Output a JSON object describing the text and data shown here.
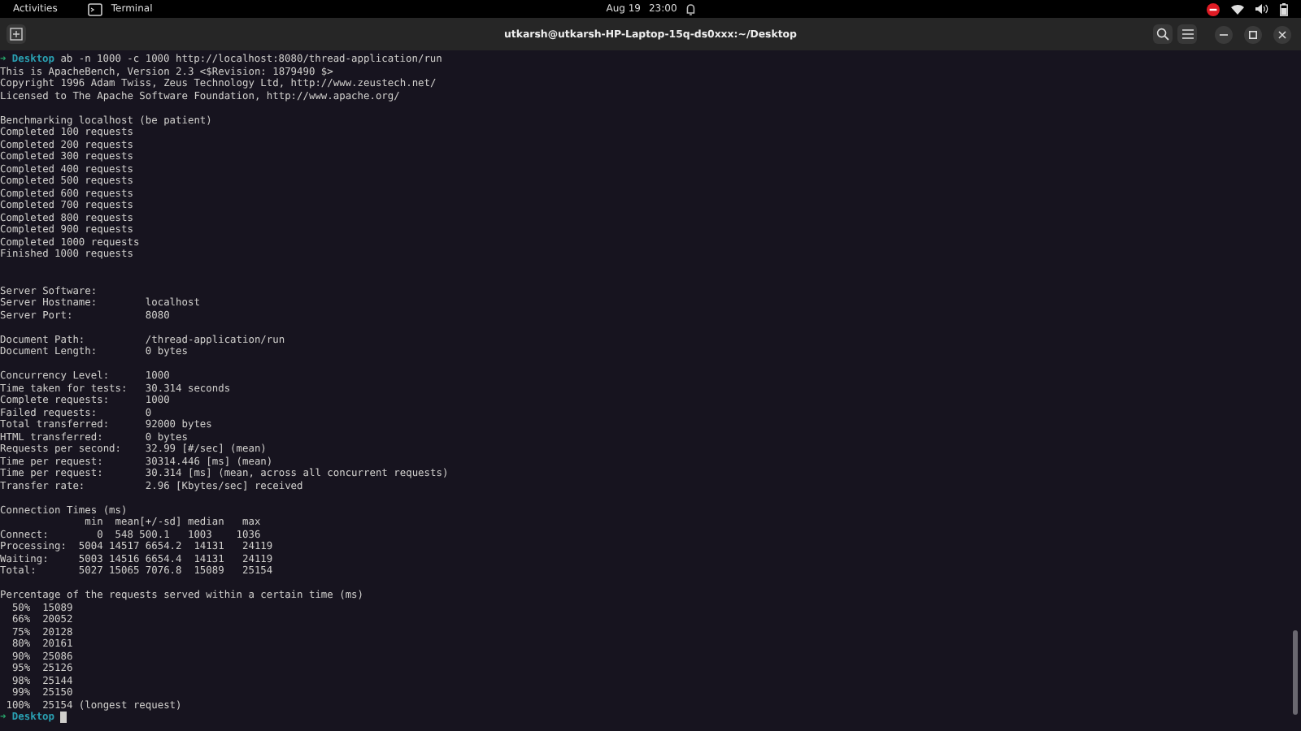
{
  "top_bar": {
    "activities": "Activities",
    "app_name": "Terminal",
    "date": "Aug 19",
    "time": "23:00"
  },
  "window": {
    "title": "utkarsh@utkarsh-HP-Laptop-15q-ds0xxx:~/Desktop"
  },
  "terminal": {
    "lines": [
      {
        "kind": "prompt",
        "arrow": "➜",
        "dir": "Desktop",
        "command": "ab -n 1000 -c 1000 http://localhost:8080/thread-application/run"
      },
      {
        "kind": "output",
        "text": "This is ApacheBench, Version 2.3 <$Revision: 1879490 $>"
      },
      {
        "kind": "output",
        "text": "Copyright 1996 Adam Twiss, Zeus Technology Ltd, http://www.zeustech.net/"
      },
      {
        "kind": "output",
        "text": "Licensed to The Apache Software Foundation, http://www.apache.org/"
      },
      {
        "kind": "blank"
      },
      {
        "kind": "output",
        "text": "Benchmarking localhost (be patient)"
      },
      {
        "kind": "output",
        "text": "Completed 100 requests"
      },
      {
        "kind": "output",
        "text": "Completed 200 requests"
      },
      {
        "kind": "output",
        "text": "Completed 300 requests"
      },
      {
        "kind": "output",
        "text": "Completed 400 requests"
      },
      {
        "kind": "output",
        "text": "Completed 500 requests"
      },
      {
        "kind": "output",
        "text": "Completed 600 requests"
      },
      {
        "kind": "output",
        "text": "Completed 700 requests"
      },
      {
        "kind": "output",
        "text": "Completed 800 requests"
      },
      {
        "kind": "output",
        "text": "Completed 900 requests"
      },
      {
        "kind": "output",
        "text": "Completed 1000 requests"
      },
      {
        "kind": "output",
        "text": "Finished 1000 requests"
      },
      {
        "kind": "blank"
      },
      {
        "kind": "blank"
      },
      {
        "kind": "output",
        "text": "Server Software:"
      },
      {
        "kind": "output",
        "text": "Server Hostname:        localhost"
      },
      {
        "kind": "output",
        "text": "Server Port:            8080"
      },
      {
        "kind": "blank"
      },
      {
        "kind": "output",
        "text": "Document Path:          /thread-application/run"
      },
      {
        "kind": "output",
        "text": "Document Length:        0 bytes"
      },
      {
        "kind": "blank"
      },
      {
        "kind": "output",
        "text": "Concurrency Level:      1000"
      },
      {
        "kind": "output",
        "text": "Time taken for tests:   30.314 seconds"
      },
      {
        "kind": "output",
        "text": "Complete requests:      1000"
      },
      {
        "kind": "output",
        "text": "Failed requests:        0"
      },
      {
        "kind": "output",
        "text": "Total transferred:      92000 bytes"
      },
      {
        "kind": "output",
        "text": "HTML transferred:       0 bytes"
      },
      {
        "kind": "output",
        "text": "Requests per second:    32.99 [#/sec] (mean)"
      },
      {
        "kind": "output",
        "text": "Time per request:       30314.446 [ms] (mean)"
      },
      {
        "kind": "output",
        "text": "Time per request:       30.314 [ms] (mean, across all concurrent requests)"
      },
      {
        "kind": "output",
        "text": "Transfer rate:          2.96 [Kbytes/sec] received"
      },
      {
        "kind": "blank"
      },
      {
        "kind": "output",
        "text": "Connection Times (ms)"
      },
      {
        "kind": "output",
        "text": "              min  mean[+/-sd] median   max"
      },
      {
        "kind": "output",
        "text": "Connect:        0  548 500.1   1003    1036"
      },
      {
        "kind": "output",
        "text": "Processing:  5004 14517 6654.2  14131   24119"
      },
      {
        "kind": "output",
        "text": "Waiting:     5003 14516 6654.4  14131   24119"
      },
      {
        "kind": "output",
        "text": "Total:       5027 15065 7076.8  15089   25154"
      },
      {
        "kind": "blank"
      },
      {
        "kind": "output",
        "text": "Percentage of the requests served within a certain time (ms)"
      },
      {
        "kind": "output",
        "text": "  50%  15089"
      },
      {
        "kind": "output",
        "text": "  66%  20052"
      },
      {
        "kind": "output",
        "text": "  75%  20128"
      },
      {
        "kind": "output",
        "text": "  80%  20161"
      },
      {
        "kind": "output",
        "text": "  90%  25086"
      },
      {
        "kind": "output",
        "text": "  95%  25126"
      },
      {
        "kind": "output",
        "text": "  98%  25144"
      },
      {
        "kind": "output",
        "text": "  99%  25150"
      },
      {
        "kind": "output",
        "text": " 100%  25154 (longest request)"
      },
      {
        "kind": "prompt",
        "arrow": "➜",
        "dir": "Desktop",
        "cursor": true
      }
    ]
  }
}
